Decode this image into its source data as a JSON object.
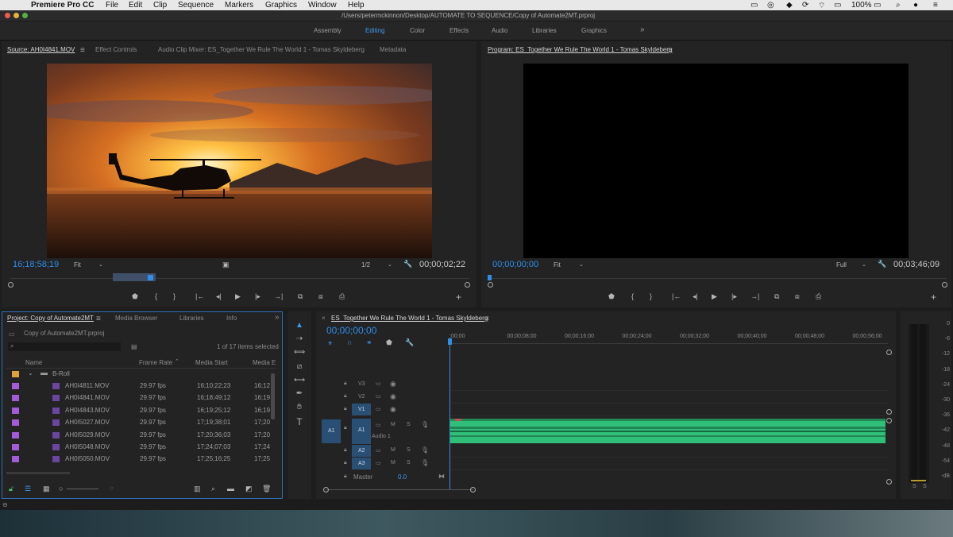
{
  "menubar": {
    "app": "Premiere Pro CC",
    "items": [
      "File",
      "Edit",
      "Clip",
      "Sequence",
      "Markers",
      "Graphics",
      "Window",
      "Help"
    ],
    "battery": "100%"
  },
  "titlebar": {
    "path": "/Users/petermckinnon/Desktop/AUTOMATE TO SEQUENCE/Copy of Automate2MT.prproj"
  },
  "workspaces": {
    "items": [
      "Assembly",
      "Editing",
      "Color",
      "Effects",
      "Audio",
      "Libraries",
      "Graphics",
      "»"
    ],
    "active": "Editing"
  },
  "source": {
    "tabs": [
      "Source: AH0I4841.MOV",
      "Effect Controls",
      "Audio Clip Mixer: ES_Together We Rule The World 1 - Tomas Skyldeberg",
      "Metadata"
    ],
    "timecode": "16;18;58;19",
    "fit": "Fit",
    "resolution": "1/2",
    "duration": "00;00;02;22"
  },
  "program": {
    "tab": "Program: ES_Together We Rule The World 1 - Tomas Skyldeberg",
    "timecode": "00;00;00;00",
    "fit": "Fit",
    "resolution": "Full",
    "duration": "00;03;46;09"
  },
  "project": {
    "tabs": [
      "Project: Copy of Automate2MT",
      "Media Browser",
      "Libraries",
      "Info"
    ],
    "file": "Copy of Automate2MT.prproj",
    "selection": "1 of 17 items selected",
    "columns": [
      "Name",
      "Frame Rate",
      "Media Start",
      "Media E"
    ],
    "bin": "B-Roll",
    "rows": [
      {
        "name": "AH0I4811.MOV",
        "rate": "29.97 fps",
        "start": "16;10;22;23",
        "end": "16;12"
      },
      {
        "name": "AH0I4841.MOV",
        "rate": "29.97 fps",
        "start": "16;18;49;12",
        "end": "16;19"
      },
      {
        "name": "AH0I4843.MOV",
        "rate": "29.97 fps",
        "start": "16;19;25;12",
        "end": "16;19"
      },
      {
        "name": "AH0I5027.MOV",
        "rate": "29.97 fps",
        "start": "17;19;38;01",
        "end": "17;20"
      },
      {
        "name": "AH0I5029.MOV",
        "rate": "29.97 fps",
        "start": "17;20;36;03",
        "end": "17;20"
      },
      {
        "name": "AH0I5048.MOV",
        "rate": "29.97 fps",
        "start": "17;24;07;03",
        "end": "17;24"
      },
      {
        "name": "AH0I5050.MOV",
        "rate": "29.97 fps",
        "start": "17;25;16;25",
        "end": "17;25"
      }
    ]
  },
  "timeline": {
    "tab": "ES_Together We Rule The World 1 - Tomas Skyldeberg",
    "timecode": "00;00;00;00",
    "ruler": [
      ";00;00",
      "00;00;08;00",
      "00;00;16;00",
      "00;00;24;00",
      "00;00;32;00",
      "00;00;40;00",
      "00;00;48;00",
      "00;00;56;00"
    ],
    "video_tracks": [
      "V3",
      "V2",
      "V1"
    ],
    "audio_tracks": [
      "A1",
      "A2",
      "A3"
    ],
    "audio1_name": "Audio 1",
    "source_patch": "A1",
    "master": {
      "label": "Master",
      "value": "0.0"
    }
  },
  "meters": {
    "labels": [
      "0",
      "-6",
      "-12",
      "-18",
      "-24",
      "-30",
      "-36",
      "-42",
      "-48",
      "-54",
      "-dB"
    ],
    "solo": [
      "S",
      "S"
    ]
  },
  "colors": {
    "accent": "#2e8ee8",
    "audio_clip": "#3ed98a",
    "clip_label": "#a25cd8",
    "folder": "#e0a23c"
  }
}
